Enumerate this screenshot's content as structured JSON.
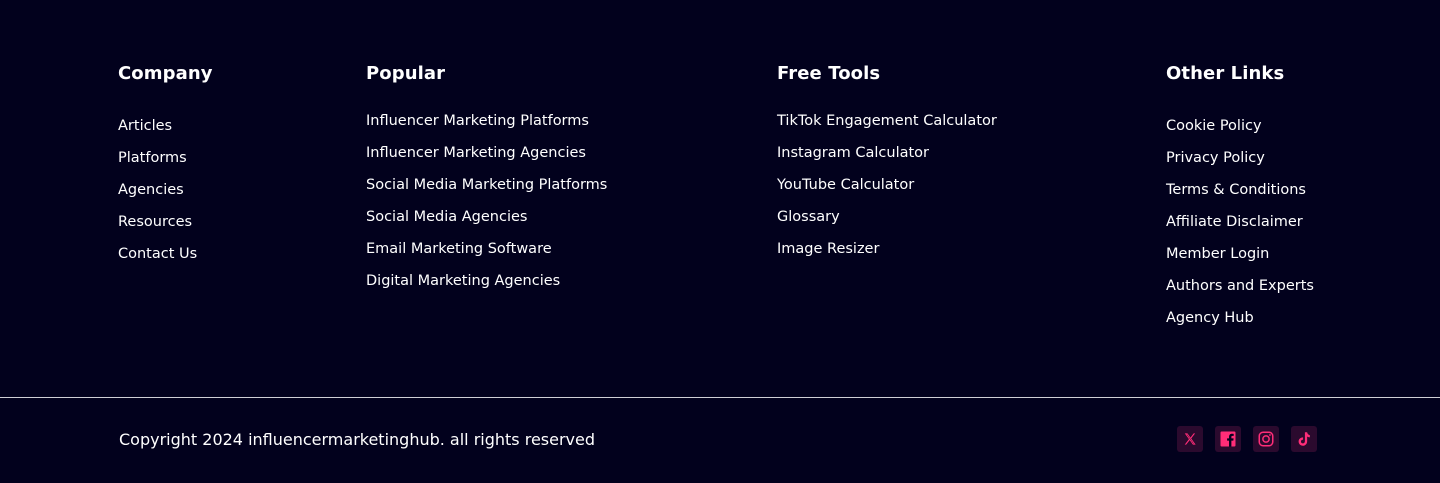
{
  "footer": {
    "company": {
      "heading": "Company",
      "links": [
        "Articles",
        "Platforms",
        "Agencies",
        "Resources",
        "Contact Us"
      ]
    },
    "popular": {
      "heading": "Popular",
      "links": [
        "Influencer Marketing Platforms",
        "Influencer Marketing Agencies",
        "Social Media Marketing Platforms",
        "Social Media Agencies",
        "Email Marketing Software",
        "Digital Marketing Agencies"
      ]
    },
    "free_tools": {
      "heading": "Free Tools",
      "links": [
        "TikTok Engagement Calculator",
        "Instagram Calculator",
        "YouTube Calculator",
        "Glossary",
        "Image Resizer"
      ]
    },
    "other_links": {
      "heading": "Other Links",
      "links": [
        "Cookie Policy",
        "Privacy Policy",
        "Terms & Conditions",
        "Affiliate Disclaimer",
        "Member Login",
        "Authors and Experts",
        "Agency Hub"
      ]
    },
    "copyright": "Copyright 2024 influencermarketinghub. all rights reserved",
    "social": [
      {
        "icon": "x-twitter-icon"
      },
      {
        "icon": "facebook-icon"
      },
      {
        "icon": "instagram-icon"
      },
      {
        "icon": "tiktok-icon"
      }
    ]
  },
  "colors": {
    "background": "#02011d",
    "text": "#ffffff",
    "divider": "#cfcfd6",
    "social_icon": "#ff2d78",
    "social_bg": "#2b0a2e"
  }
}
